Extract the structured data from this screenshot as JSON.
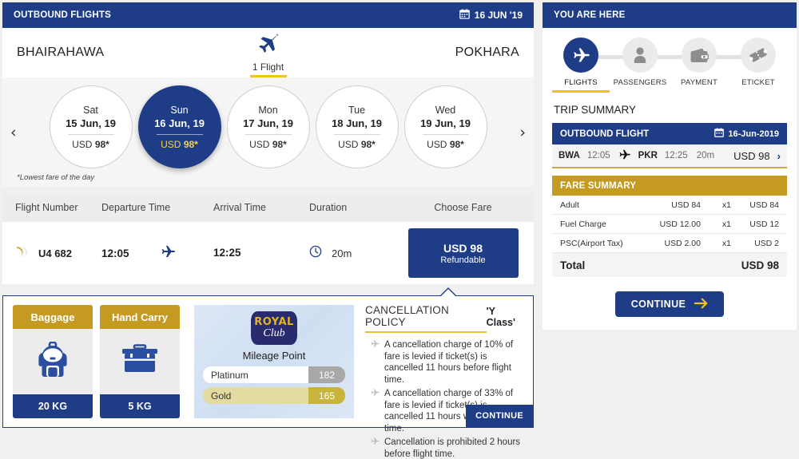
{
  "outbound": {
    "header_title": "OUTBOUND FLIGHTS",
    "header_date": "16 JUN '19",
    "origin": "BHAIRAHAWA",
    "destination": "POKHARA",
    "flights_count": "1 Flight"
  },
  "carousel": {
    "prev_label": "‹",
    "next_label": "›",
    "lowest_note": "*Lowest fare of the day",
    "dates": [
      {
        "dow": "Sat",
        "date": "15 Jun, 19",
        "currency": "USD",
        "amount": "98*",
        "selected": false
      },
      {
        "dow": "Sun",
        "date": "16 Jun, 19",
        "currency": "USD",
        "amount": "98*",
        "selected": true
      },
      {
        "dow": "Mon",
        "date": "17 Jun, 19",
        "currency": "USD",
        "amount": "98*",
        "selected": false
      },
      {
        "dow": "Tue",
        "date": "18 Jun, 19",
        "currency": "USD",
        "amount": "98*",
        "selected": false
      },
      {
        "dow": "Wed",
        "date": "19 Jun, 19",
        "currency": "USD",
        "amount": "98*",
        "selected": false
      }
    ]
  },
  "results": {
    "columns": [
      "Flight Number",
      "Departure Time",
      "Arrival Time",
      "Duration",
      "Choose Fare"
    ],
    "row": {
      "flight_number": "U4 682",
      "departure_time": "12:05",
      "arrival_time": "12:25",
      "duration": "20m",
      "fare_amount": "USD 98",
      "fare_type": "Refundable"
    }
  },
  "detail": {
    "baggage": {
      "title": "Baggage",
      "weight": "20 KG"
    },
    "hand_carry": {
      "title": "Hand Carry",
      "weight": "5 KG"
    },
    "royal_club": {
      "logo_line1": "ROYAL",
      "logo_line2": "Club",
      "mileage_title": "Mileage Point",
      "tiers": [
        {
          "label": "Platinum",
          "value": "182"
        },
        {
          "label": "Gold",
          "value": "165"
        }
      ]
    },
    "cancellation": {
      "title": "CANCELLATION POLICY",
      "class": "'Y Class'",
      "items": [
        "A cancellation charge of 10% of fare is levied if ticket(s) is cancelled 11 hours before flight time.",
        "A cancellation charge of 33% of fare is levied if ticket(s) is cancelled 11 hours within flight time.",
        "Cancellation is prohibited 2 hours before flight time."
      ],
      "continue_label": "CONTINUE"
    }
  },
  "right": {
    "header_title": "YOU ARE HERE",
    "steps": [
      {
        "label": "FLIGHTS",
        "icon": "plane-icon",
        "active": true
      },
      {
        "label": "PASSENGERS",
        "icon": "person-icon",
        "active": false
      },
      {
        "label": "PAYMENT",
        "icon": "wallet-icon",
        "active": false
      },
      {
        "label": "ETICKET",
        "icon": "ticket-icon",
        "active": false
      }
    ],
    "trip_summary": {
      "title": "TRIP SUMMARY",
      "section_label": "OUTBOUND FLIGHT",
      "section_date": "16-Jun-2019",
      "origin_code": "BWA",
      "origin_time": "12:05",
      "dest_code": "PKR",
      "dest_time": "12:25",
      "duration": "20m",
      "price": "USD 98",
      "chevron": "›"
    },
    "fare_summary": {
      "title": "FARE SUMMARY",
      "rows": [
        {
          "label": "Adult",
          "unit": "USD 84",
          "qty": "x1",
          "total": "USD 84"
        },
        {
          "label": "Fuel Charge",
          "unit": "USD 12.00",
          "qty": "x1",
          "total": "USD 12"
        },
        {
          "label": "PSC(Airport Tax)",
          "unit": "USD 2.00",
          "qty": "x1",
          "total": "USD 2"
        }
      ],
      "total_label": "Total",
      "total_value": "USD 98"
    },
    "continue_label": "CONTINUE"
  },
  "colors": {
    "brand_navy": "#1f3d87",
    "brand_gold": "#c49a22",
    "accent_yellow": "#f0c419",
    "page_bg": "#f0f0f0"
  }
}
